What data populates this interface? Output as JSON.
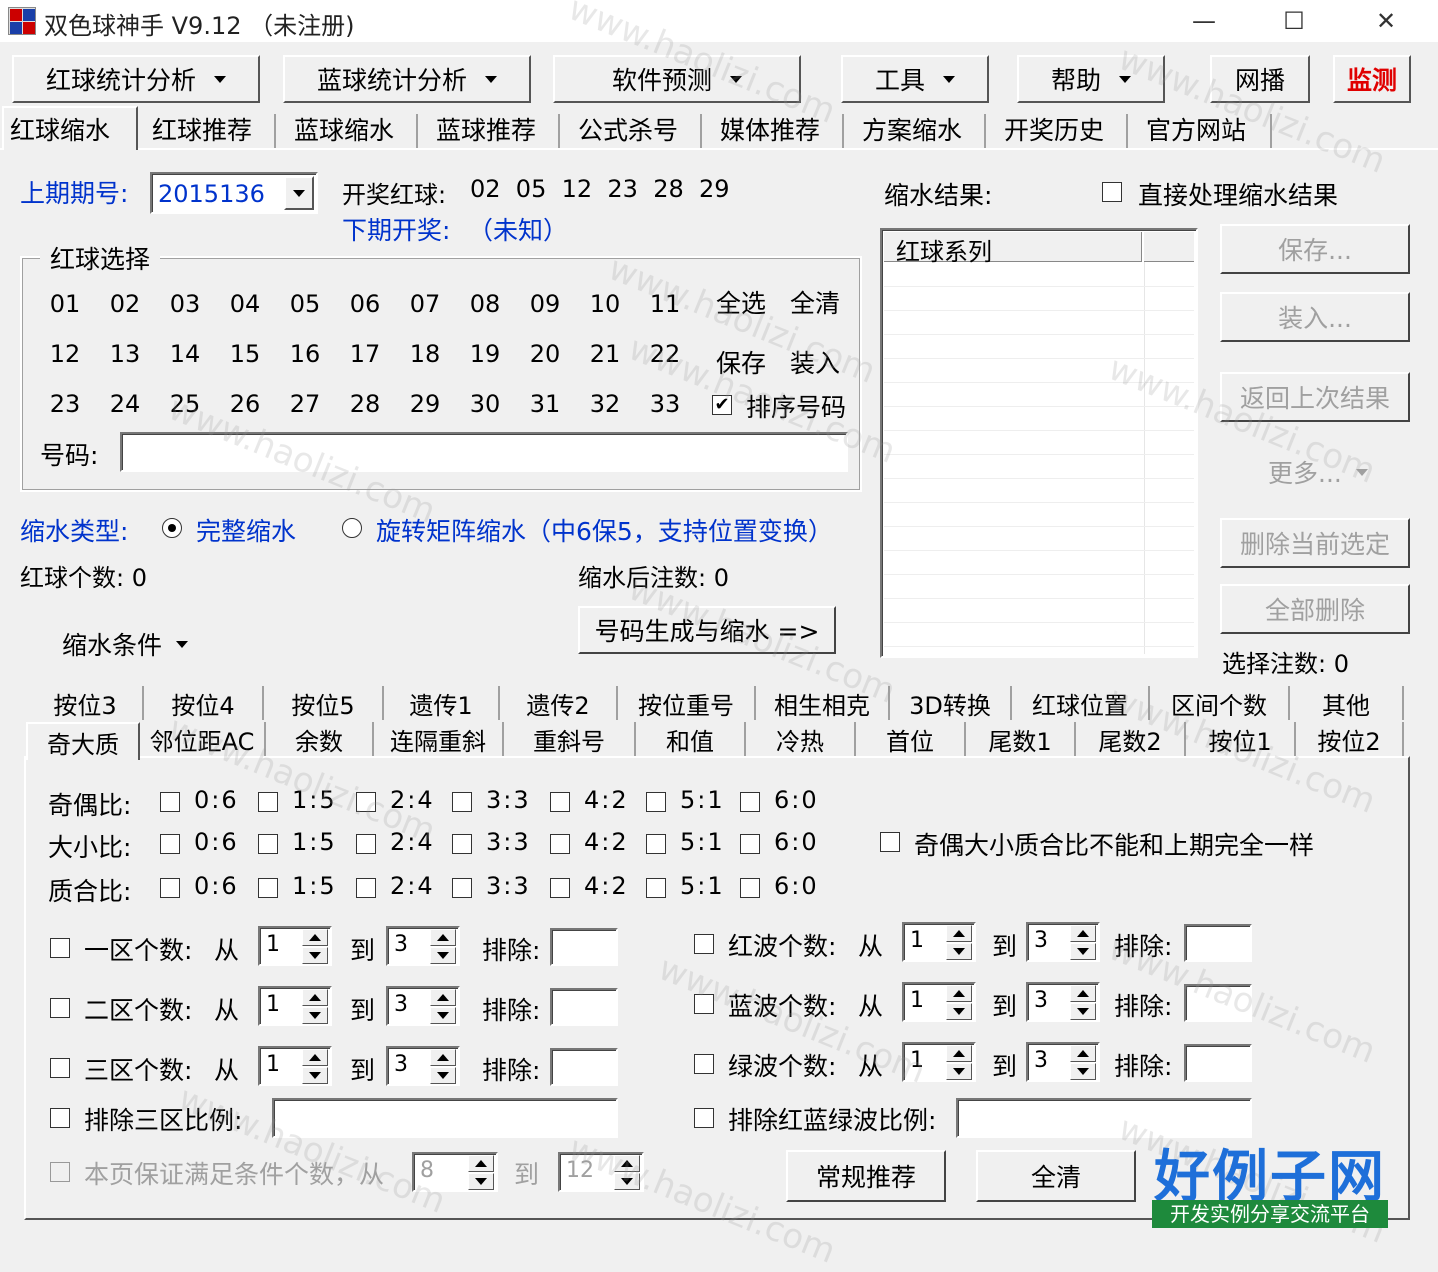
{
  "window": {
    "title": "双色球神手 V9.12 （未注册)",
    "minimize": "—",
    "maximize": "☐",
    "close": "✕"
  },
  "menu": [
    {
      "label": "红球统计分析"
    },
    {
      "label": "蓝球统计分析"
    },
    {
      "label": "软件预测"
    },
    {
      "label": "工具"
    },
    {
      "label": "帮助"
    },
    {
      "label": "网播"
    },
    {
      "label": "监测",
      "color": "#e00000"
    }
  ],
  "tabs": [
    "红球缩水",
    "红球推荐",
    "蓝球缩水",
    "蓝球推荐",
    "公式杀号",
    "媒体推荐",
    "方案缩水",
    "开奖历史",
    "官方网站"
  ],
  "issue": {
    "label": "上期期号:",
    "value": "2015136",
    "draw_label": "开奖红球:",
    "draw_numbers": "02  05  12  23  28  29",
    "next_label": "下期开奖:",
    "next_value": "（未知）"
  },
  "red_select": {
    "title": "红球选择",
    "numbers": [
      "01",
      "02",
      "03",
      "04",
      "05",
      "06",
      "07",
      "08",
      "09",
      "10",
      "11",
      "12",
      "13",
      "14",
      "15",
      "16",
      "17",
      "18",
      "19",
      "20",
      "21",
      "22",
      "23",
      "24",
      "25",
      "26",
      "27",
      "28",
      "29",
      "30",
      "31",
      "32",
      "33"
    ],
    "select_all": "全选",
    "clear_all": "全清",
    "save": "保存",
    "load": "装入",
    "sort_label": "排序号码",
    "sort_checked": true,
    "code_label": "号码:",
    "code_value": ""
  },
  "filter_type": {
    "label": "缩水类型:",
    "option1": "完整缩水",
    "option2": "旋转矩阵缩水（中6保5，支持位置变换）"
  },
  "counts": {
    "red_count": "红球个数: 0",
    "after_count": "缩水后注数: 0",
    "condition": "缩水条件",
    "generate": "号码生成与缩水 =>"
  },
  "result": {
    "label": "缩水结果:",
    "direct_label": "直接处理缩水结果",
    "column": "红球系列",
    "save": "保存...",
    "load": "装入...",
    "back": "返回上次结果",
    "more": "更多...",
    "delete_sel": "删除当前选定",
    "delete_all": "全部删除",
    "selected": "选择注数: 0"
  },
  "subtabs_row1": [
    "按位3",
    "按位4",
    "按位5",
    "遗传1",
    "遗传2",
    "按位重号",
    "相生相克",
    "3D转换",
    "红球位置",
    "区间个数",
    "其他"
  ],
  "subtabs_row2": [
    "奇大质",
    "邻位距AC",
    "余数",
    "连隔重斜",
    "重斜号",
    "和值",
    "冷热",
    "首位",
    "尾数1",
    "尾数2",
    "按位1",
    "按位2"
  ],
  "ratios": {
    "rows": [
      {
        "label": "奇偶比:"
      },
      {
        "label": "大小比:"
      },
      {
        "label": "质合比:"
      }
    ],
    "options": [
      "0:6",
      "1:5",
      "2:4",
      "3:3",
      "4:2",
      "5:1",
      "6:0"
    ],
    "same_label": "奇偶大小质合比不能和上期完全一样"
  },
  "zones": {
    "from": "从",
    "to": "到",
    "exclude": "排除:",
    "left": [
      {
        "label": "一区个数:",
        "from": "1",
        "to": "3"
      },
      {
        "label": "二区个数:",
        "from": "1",
        "to": "3"
      },
      {
        "label": "三区个数:",
        "from": "1",
        "to": "3"
      }
    ],
    "right": [
      {
        "label": "红波个数:",
        "from": "1",
        "to": "3"
      },
      {
        "label": "蓝波个数:",
        "from": "1",
        "to": "3"
      },
      {
        "label": "绿波个数:",
        "from": "1",
        "to": "3"
      }
    ],
    "exclude_zone_ratio": "排除三区比例:",
    "exclude_wave_ratio": "排除红蓝绿波比例:",
    "guarantee_label": "本页保证满足条件个数，从",
    "guarantee_from": "8",
    "guarantee_to_label": "到",
    "guarantee_to": "12",
    "normal_recommend": "常规推荐",
    "clear": "全清"
  },
  "watermark": {
    "text": "www.haolizi.com",
    "logo_big": "好例子网",
    "logo_small": "开发实例分享交流平台"
  }
}
